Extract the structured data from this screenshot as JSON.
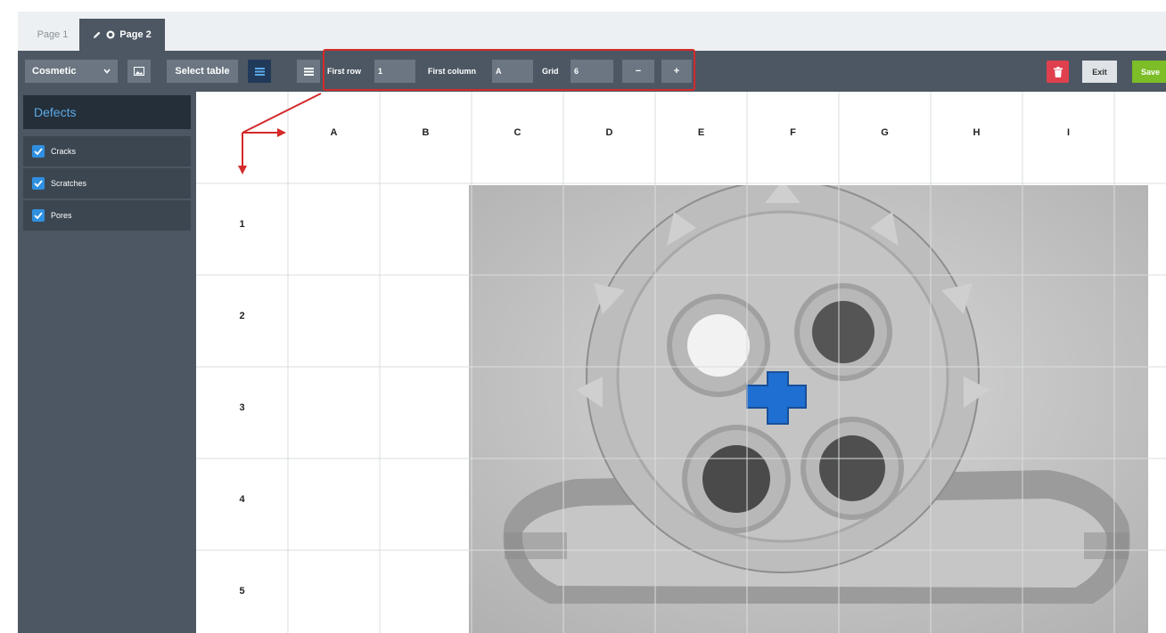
{
  "tabs": [
    {
      "label": "Page 1",
      "active": false
    },
    {
      "label": "Page 2",
      "active": true
    }
  ],
  "toolbar": {
    "category": "Cosmetic",
    "select_table_label": "Select table",
    "first_row_label": "First row",
    "first_row_value": "1",
    "first_column_label": "First column",
    "first_column_value": "A",
    "grid_label": "Grid",
    "grid_value": "6",
    "minus_label": "−",
    "plus_label": "+",
    "exit_label": "Exit",
    "save_label": "Save"
  },
  "sidebar": {
    "title": "Defects",
    "items": [
      {
        "label": "Cracks",
        "checked": true
      },
      {
        "label": "Scratches",
        "checked": true
      },
      {
        "label": "Pores",
        "checked": true
      }
    ]
  },
  "grid": {
    "columns": [
      "A",
      "B",
      "C",
      "D",
      "E",
      "F",
      "G",
      "H",
      "I"
    ],
    "rows": [
      "1",
      "2",
      "3",
      "4",
      "5"
    ]
  },
  "colors": {
    "accent_red": "#d42a2a",
    "accent_blue": "#2e8fe0",
    "save_green": "#7cbd28",
    "delete_red": "#e0404e",
    "toolbar_bg": "#4c5763"
  }
}
